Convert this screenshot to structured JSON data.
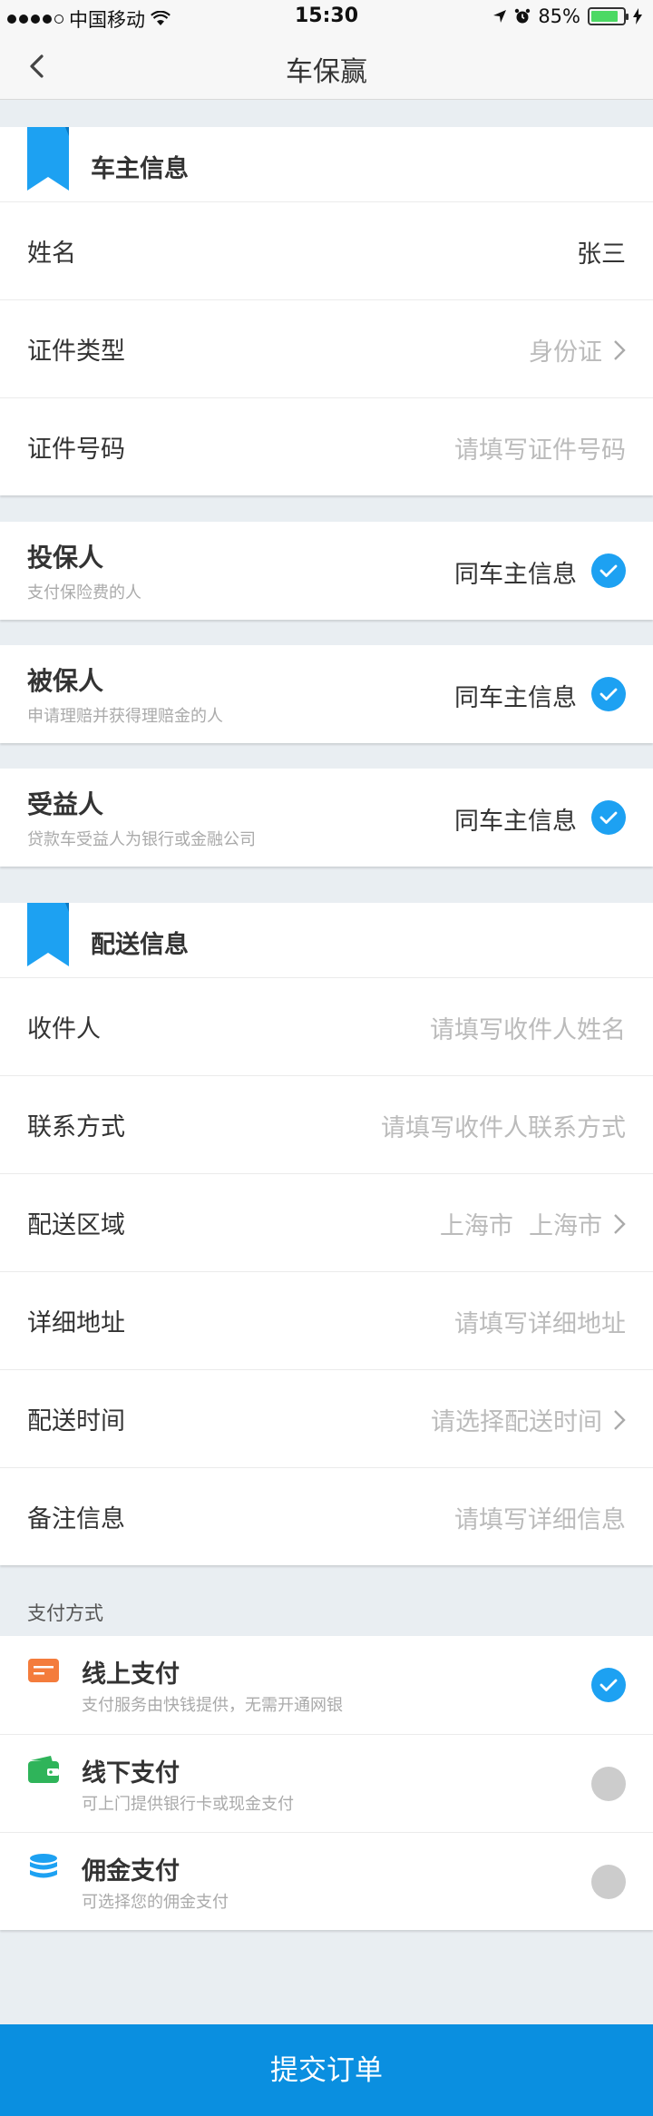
{
  "status_bar": {
    "carrier": "中国移动",
    "time": "15:30",
    "battery": "85%",
    "battery_level": 0.85
  },
  "nav": {
    "title": "车保赢"
  },
  "owner": {
    "title": "车主信息",
    "rows": [
      {
        "label": "姓名",
        "value": "张三"
      },
      {
        "label": "证件类型",
        "value": "身份证"
      },
      {
        "label": "证件号码",
        "placeholder": "请填写证件号码"
      }
    ]
  },
  "parties": [
    {
      "name": "投保人",
      "desc": "支付保险费的人",
      "same": "同车主信息",
      "checked": true
    },
    {
      "name": "被保人",
      "desc": "申请理赔并获得理赔金的人",
      "same": "同车主信息",
      "checked": true
    },
    {
      "name": "受益人",
      "desc": "贷款车受益人为银行或金融公司",
      "same": "同车主信息",
      "checked": true
    }
  ],
  "delivery": {
    "title": "配送信息",
    "rows": [
      {
        "label": "收件人",
        "placeholder": "请填写收件人姓名"
      },
      {
        "label": "联系方式",
        "placeholder": "请填写收件人联系方式"
      },
      {
        "label": "配送区域",
        "value": "上海市  上海市"
      },
      {
        "label": "详细地址",
        "placeholder": "请填写详细地址"
      },
      {
        "label": "配送时间",
        "placeholder": "请选择配送时间"
      },
      {
        "label": "备注信息",
        "placeholder": "请填写详细信息"
      }
    ]
  },
  "payment": {
    "label": "支付方式",
    "options": [
      {
        "name": "线上支付",
        "desc": "支付服务由快钱提供，无需开通网银",
        "icon": "card-icon",
        "selected": true
      },
      {
        "name": "线下支付",
        "desc": "可上门提供银行卡或现金支付",
        "icon": "wallet-icon",
        "selected": false
      },
      {
        "name": "佣金支付",
        "desc": "可选择您的佣金支付",
        "icon": "coins-icon",
        "selected": false
      }
    ]
  },
  "submit_label": "提交订单",
  "colors": {
    "accent": "#1da1f2",
    "submit": "#0a8fe0",
    "card_icon": "#f47c3c",
    "wallet_icon": "#2fb45a",
    "coins_icon": "#1da1f2"
  }
}
